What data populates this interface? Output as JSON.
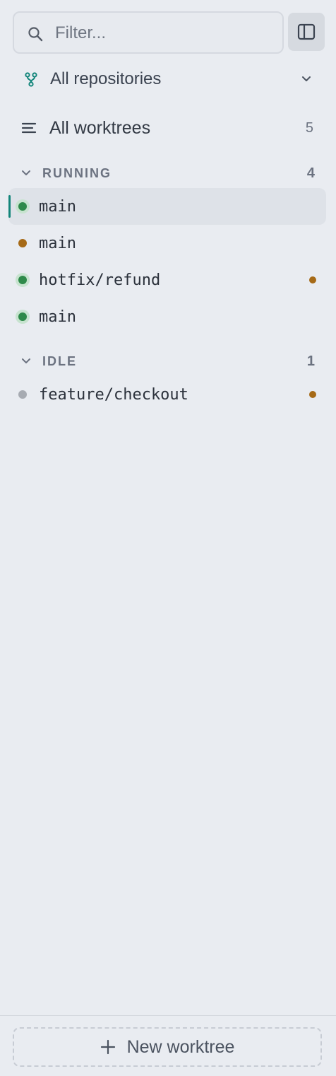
{
  "search": {
    "placeholder": "Filter..."
  },
  "repo_filter": {
    "label": "All repositories"
  },
  "all_worktrees": {
    "label": "All worktrees",
    "count": "5"
  },
  "sections": [
    {
      "title": "RUNNING",
      "count": "4",
      "items": [
        {
          "name": "main",
          "status": "running",
          "active": true,
          "changes": false
        },
        {
          "name": "main",
          "status": "pending",
          "active": false,
          "changes": false
        },
        {
          "name": "hotfix/refund",
          "status": "running",
          "active": false,
          "changes": true
        },
        {
          "name": "main",
          "status": "running",
          "active": false,
          "changes": false
        }
      ]
    },
    {
      "title": "IDLE",
      "count": "1",
      "items": [
        {
          "name": "feature/checkout",
          "status": "idle",
          "active": false,
          "changes": true
        }
      ]
    }
  ],
  "footer": {
    "new_worktree_label": "New worktree"
  },
  "colors": {
    "accent": "#12857a",
    "running": "#2e8a4a",
    "pending": "#a66a17",
    "idle": "#a7abb2",
    "changes": "#a66a17"
  },
  "icons": [
    "search-icon",
    "sidebar-toggle-icon",
    "repo-branch-icon",
    "chevron-down-icon",
    "list-lines-icon",
    "plus-icon"
  ]
}
